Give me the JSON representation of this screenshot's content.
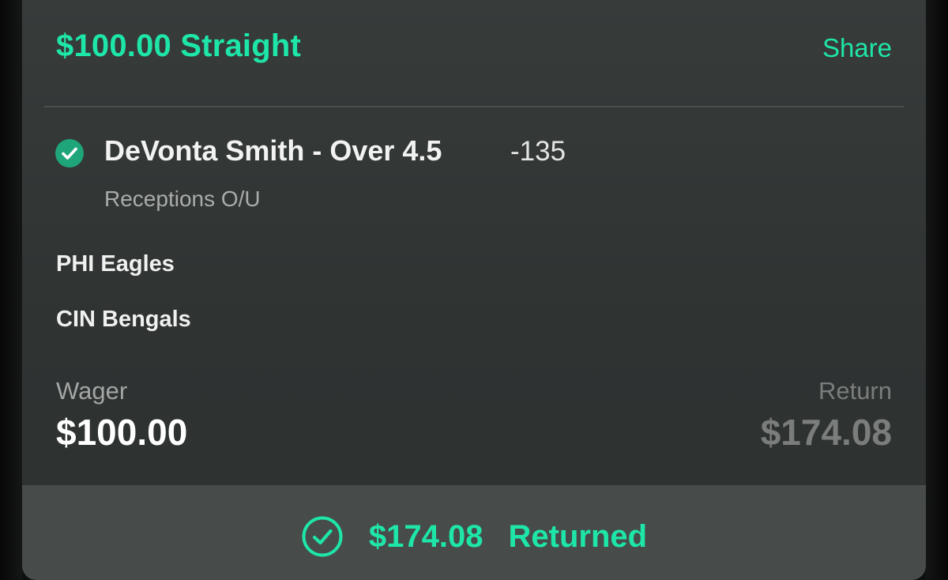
{
  "bet": {
    "title": "$100.00 Straight",
    "share_label": "Share"
  },
  "selection": {
    "name": "DeVonta Smith - Over 4.5",
    "odds": "-135",
    "market": "Receptions O/U",
    "status_icon": "check-circle-icon"
  },
  "matchup": {
    "team_1": "PHI Eagles",
    "team_2": "CIN Bengals"
  },
  "wager": {
    "label": "Wager",
    "amount": "$100.00"
  },
  "return": {
    "label": "Return",
    "amount": "$174.08"
  },
  "footer": {
    "amount": "$174.08",
    "status": "Returned",
    "icon": "check-circle-outline-icon"
  },
  "colors": {
    "accent": "#1ee6a8",
    "card_background": "#333736",
    "footer_background": "#474b4a",
    "check_badge": "#1fa57a",
    "muted_text": "#7a7d7c"
  }
}
